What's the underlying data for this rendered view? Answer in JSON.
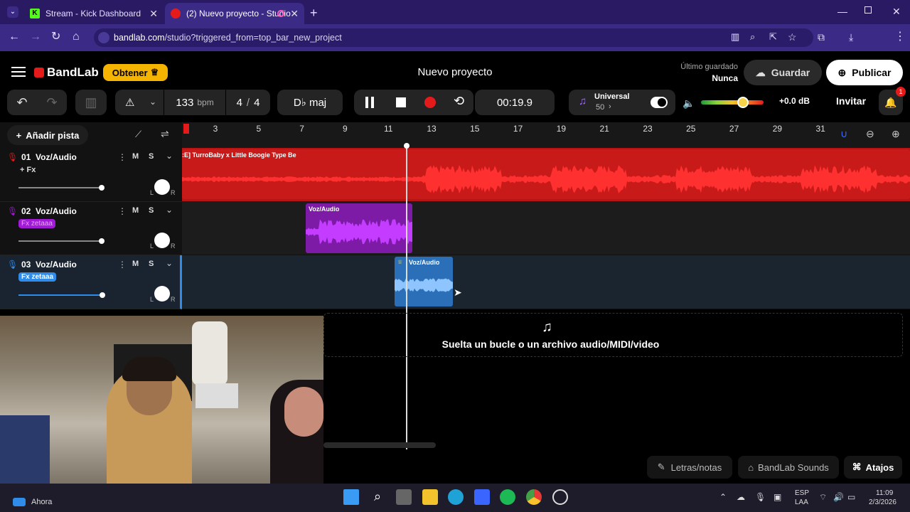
{
  "browser": {
    "tabs": [
      {
        "title": "Stream - Kick Dashboard"
      },
      {
        "title": "(2) Nuevo proyecto - Studio"
      }
    ],
    "url_host": "bandlab.com",
    "url_path": "/studio?triggered_from=top_bar_new_project"
  },
  "app": {
    "brand": "BandLab",
    "obtener_label": "Obtener",
    "project_title": "Nuevo proyecto",
    "last_saved_label": "Último guardado",
    "last_saved_value": "Nunca",
    "save_label": "Guardar",
    "publish_label": "Publicar",
    "accent_color": "#f5b400"
  },
  "transport": {
    "bpm_value": "133",
    "bpm_unit": "bpm",
    "time_sig_num": "4",
    "time_sig_sep": "/",
    "time_sig_den": "4",
    "key": "D♭ maj",
    "time": "00:19.9",
    "preset_name": "Universal",
    "preset_level": "50",
    "master_db": "+0.0 dB",
    "invite_label": "Invitar",
    "notifications_count": "1"
  },
  "tracks_panel": {
    "add_track_label": "Añadir pista",
    "ruler": [
      "3",
      "5",
      "7",
      "9",
      "11",
      "13",
      "15",
      "17",
      "19",
      "21",
      "23",
      "25",
      "27",
      "29",
      "31"
    ],
    "tracks": [
      {
        "number": "01",
        "name": "Voz/Audio",
        "fx": "+ Fx",
        "mute": "M",
        "solo": "S",
        "pan_l": "L",
        "pan_r": "R",
        "color": "#e51b1b",
        "clip_label": ":E] TurroBaby x Little Boogie Type Be"
      },
      {
        "number": "02",
        "name": "Voz/Audio",
        "fx": "Fx zetaaa",
        "mute": "M",
        "solo": "S",
        "pan_l": "L",
        "pan_r": "R",
        "color": "#a11ad6",
        "clip_label": "Voz/Audio"
      },
      {
        "number": "03",
        "name": "Voz/Audio",
        "fx": "Fx zetaaa",
        "mute": "M",
        "solo": "S",
        "pan_l": "L",
        "pan_r": "R",
        "color": "#2f8ce8",
        "clip_label": "Voz/Audio"
      }
    ],
    "drop_hint": "Suelta un bucle o un archivo audio/MIDI/video"
  },
  "bottom": {
    "lyrics_label": "Letras/notas",
    "sounds_label": "BandLab Sounds",
    "shortcuts_label": "Atajos"
  },
  "taskbar": {
    "notif_label": "Ahora",
    "lang_line1": "ESP",
    "lang_line2": "LAA",
    "clock_time": "11:09",
    "clock_date": "2/3/2026"
  }
}
